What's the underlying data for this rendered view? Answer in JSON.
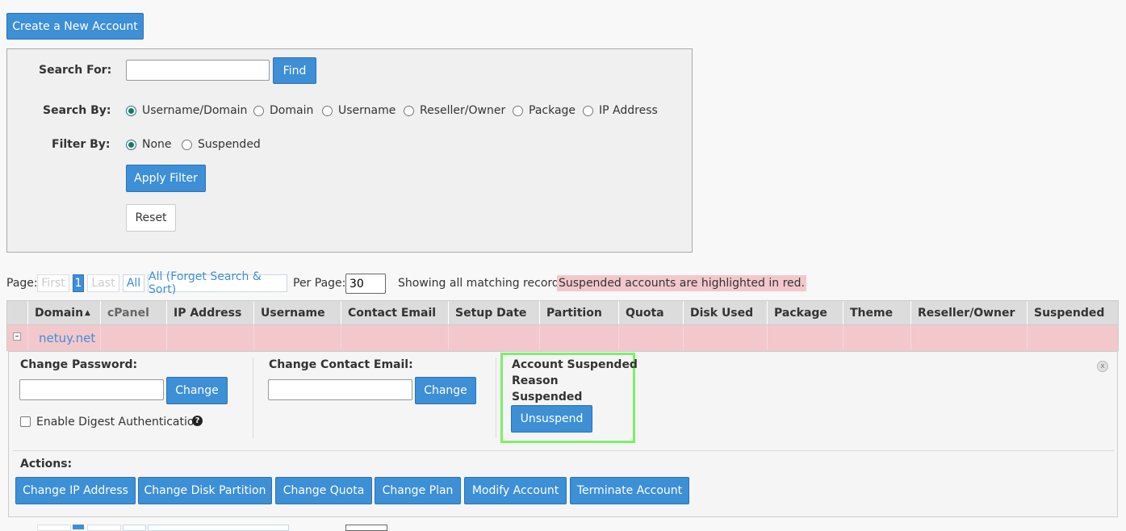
{
  "create_button": "Create a New Account",
  "search": {
    "label": "Search For:",
    "value": "",
    "find": "Find",
    "search_by_label": "Search By:",
    "search_by_options": [
      "Username/Domain",
      "Domain",
      "Username",
      "Reseller/Owner",
      "Package",
      "IP Address"
    ],
    "search_by_selected": "Username/Domain",
    "filter_by_label": "Filter By:",
    "filter_options": [
      "None",
      "Suspended"
    ],
    "filter_selected": "None",
    "apply_filter": "Apply Filter",
    "reset": "Reset"
  },
  "pager": {
    "page_label": "Page:",
    "first": "First",
    "current": "1",
    "last": "Last",
    "all": "All",
    "forget": "All (Forget Search & Sort)",
    "per_page_label": "Per Page:",
    "per_page_value": "30",
    "showing": "Showing all matching records.",
    "suspended_note": "Suspended accounts are highlighted in red."
  },
  "table": {
    "columns": [
      "Domain",
      "cPanel",
      "IP Address",
      "Username",
      "Contact Email",
      "Setup Date",
      "Partition",
      "Quota",
      "Disk Used",
      "Package",
      "Theme",
      "Reseller/Owner",
      "Suspended"
    ],
    "sort_indicator": "▲",
    "row": {
      "toggle": "⊟",
      "domain": "netuy.net"
    }
  },
  "detail": {
    "change_password_label": "Change Password:",
    "change_password_button": "Change",
    "digest_label": "Enable Digest Authentication",
    "help_icon": "?",
    "change_email_label": "Change Contact Email:",
    "change_email_button": "Change",
    "suspended_title": "Account Suspended",
    "reason_label": "Reason",
    "reason_value": "Suspended",
    "unsuspend": "Unsuspend",
    "close_icon": "x",
    "actions_label": "Actions:",
    "actions": [
      "Change IP Address",
      "Change Disk Partition",
      "Change Quota",
      "Change Plan",
      "Modify Account",
      "Terminate Account"
    ]
  },
  "colors": {
    "primary": "#3d8fd6",
    "suspended_row": "#f2c8cd",
    "highlight_box": "#7cf06a"
  }
}
